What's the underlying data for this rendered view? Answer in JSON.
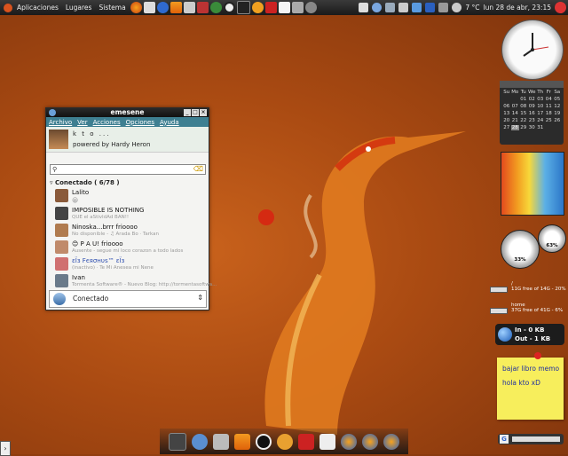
{
  "top_panel": {
    "menus": [
      "Aplicaciones",
      "Lugares",
      "Sistema"
    ],
    "temperature": "7 °C",
    "datetime": "lun 28 de abr, 23:15"
  },
  "messenger": {
    "title": "emesene",
    "menu": [
      "Archivo",
      "Ver",
      "Acciones",
      "Opciones",
      "Ayuda"
    ],
    "nickname": "k t o ...",
    "personal_message": "powered by Hardy Heron",
    "group": "Conectado ( 6/78 )",
    "contacts": [
      {
        "name": "Lalito",
        "message": "😀",
        "avatar_color": "#8a5a3a"
      },
      {
        "name": "IMPOSIBLE IS NOTHING",
        "message": "QUE el aStivIdAd BAN!!",
        "avatar_color": "#444444"
      },
      {
        "name": "Ninoska...brrr  frioooo",
        "message": "No disponible - ♫ Arada Bo · Tarkan",
        "avatar_color": "#b07b4e"
      },
      {
        "name": "😊 P A U!           frioooo",
        "message": "Ausente - segue mi loco corazon a todo lados",
        "avatar_color": "#c08a6a"
      },
      {
        "name": "εÏз Fєяσнυѕ™ εÏз",
        "message": "(inactivo) · Te Mi Anesea mi Nene",
        "avatar_color": "#d07070"
      },
      {
        "name": "Ivan",
        "message": "Tormenta Software® - Nuevo Blog: http://tormentasoftwa...",
        "avatar_color": "#6a7a8a"
      }
    ],
    "status": "Conectado"
  },
  "calendar": {
    "weekdays": [
      "Su",
      "Mo",
      "Tu",
      "We",
      "Th",
      "Fr",
      "Sa"
    ],
    "days": [
      "",
      "",
      "01",
      "02",
      "03",
      "04",
      "05",
      "06",
      "07",
      "08",
      "09",
      "10",
      "11",
      "12",
      "13",
      "14",
      "15",
      "16",
      "17",
      "18",
      "19",
      "20",
      "21",
      "22",
      "23",
      "24",
      "25",
      "26",
      "27",
      "28",
      "29",
      "30",
      "31",
      "",
      ""
    ],
    "today": "28"
  },
  "gauges": {
    "cpu": "33%",
    "mem": "63%"
  },
  "drives": [
    {
      "title": "/",
      "free": "11G free of 14G - 20%"
    },
    {
      "title": "home",
      "free": "37G free of 41G - 6%"
    }
  ],
  "network": {
    "in": "In -   0  KB",
    "out": "Out - 1  KB"
  },
  "note": {
    "line1": "bajar libro memo",
    "line2": "hola  kto  xD"
  },
  "search_widget": {
    "logo": "G"
  },
  "show_desktop": "›"
}
